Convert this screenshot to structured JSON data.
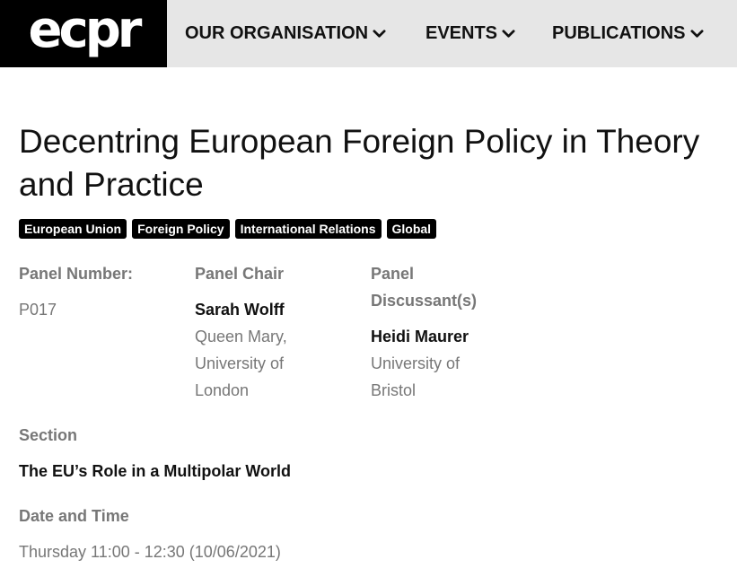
{
  "header": {
    "logo_text": "ecpr",
    "nav": [
      {
        "label": "OUR ORGANISATION"
      },
      {
        "label": "EVENTS"
      },
      {
        "label": "PUBLICATIONS"
      }
    ]
  },
  "panel": {
    "title": "Decentring European Foreign Policy in Theory and Practice",
    "tags": [
      "European Union",
      "Foreign Policy",
      "International Relations",
      "Global"
    ],
    "number_label": "Panel Number:",
    "number_value": "P017",
    "chair_label": "Panel Chair",
    "chair_name": "Sarah Wolff",
    "chair_affiliation": "Queen Mary, University of London",
    "discussant_label": "Panel Discussant(s)",
    "discussant_name": "Heidi Maurer",
    "discussant_affiliation": "University of Bristol",
    "section_label": "Section",
    "section_value": "The EU’s Role in a Multipolar World",
    "datetime_label": "Date and Time",
    "datetime_value": "Thursday 11:00 - 12:30 (10/06/2021)"
  },
  "icons": {
    "nav_chevron": "chevron-down-icon"
  }
}
